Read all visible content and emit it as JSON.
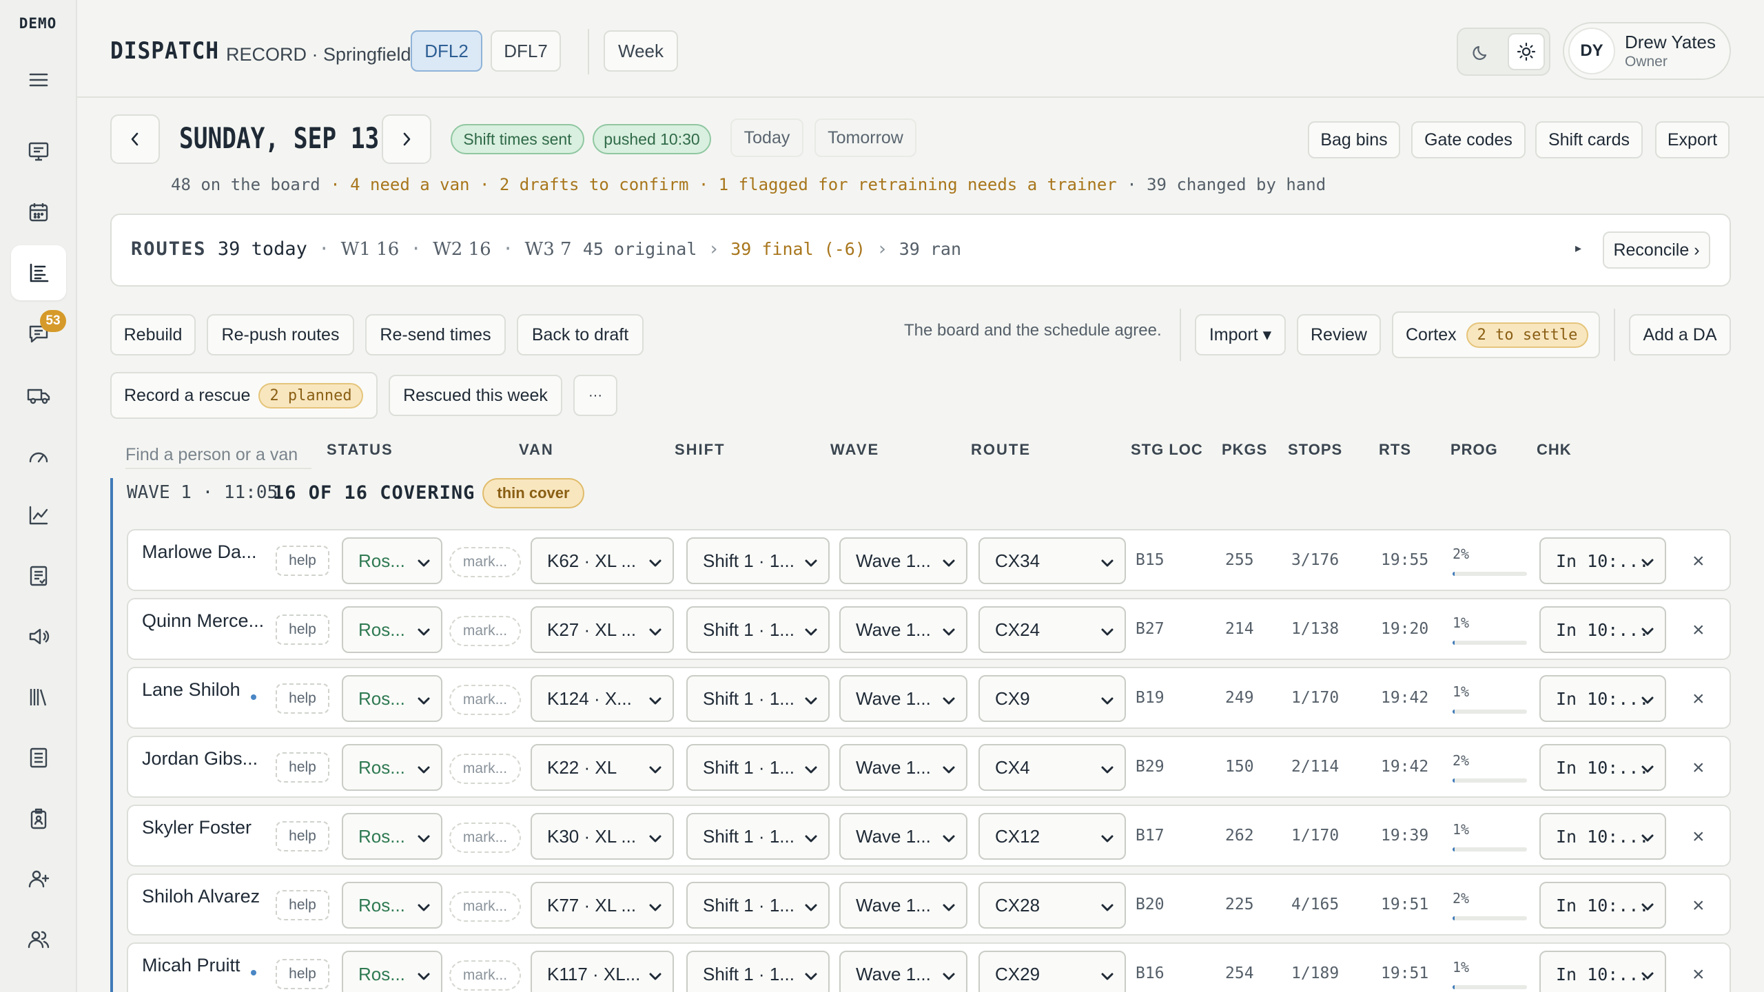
{
  "sidebar": {
    "logo": "DEMO",
    "message_count": "53",
    "icons": [
      "menu-icon",
      "monitor-icon",
      "calendar-icon",
      "dispatch-board-icon",
      "messages-icon",
      "truck-icon",
      "gauge-icon",
      "chart-icon",
      "report-icon",
      "announce-icon",
      "library-icon",
      "checklist-icon",
      "badge-icon",
      "add-user-icon",
      "people-icon"
    ]
  },
  "header": {
    "app": "DISPATCH",
    "mode": "RECORD · Springfield",
    "stations": [
      "DFL2",
      "DFL7"
    ],
    "active_station": "DFL2",
    "week": "Week",
    "user_initials": "DY",
    "user_name": "Drew Yates",
    "user_role": "Owner"
  },
  "date_bar": {
    "title": "SUNDAY, SEP 13",
    "pill_sent": "Shift times sent",
    "pill_pushed": "pushed 10:30",
    "today": "Today",
    "tomorrow": "Tomorrow",
    "actions": [
      "Bag bins",
      "Gate codes",
      "Shift cards",
      "Export"
    ]
  },
  "summary": {
    "on_board": "48 on the board",
    "sep": "·",
    "need_van": "4 need a van",
    "drafts": "2 drafts to confirm",
    "flagged": "1 flagged for retraining needs a trainer",
    "changed": "39 changed by hand"
  },
  "routes": {
    "label": "ROUTES",
    "today": "39 today",
    "w1": "W1 16",
    "w2": "W2 16",
    "w3": "W3 7",
    "original": "45 original",
    "arrow": "›",
    "final": "39 final (-6)",
    "ran": "39 ran",
    "tri": "▸",
    "reconcile": "Reconcile ›"
  },
  "toolbar": {
    "rebuild": "Rebuild",
    "repush": "Re-push routes",
    "resend": "Re-send times",
    "back": "Back to draft",
    "agree": "The board and the schedule agree.",
    "import": "Import ▾",
    "review": "Review",
    "cortex": "Cortex",
    "cortex_badge": "2 to settle",
    "add_da": "Add a DA",
    "rescue": "Record a rescue",
    "rescue_badge": "2 planned",
    "rescued_week": "Rescued this week",
    "more": "···"
  },
  "table": {
    "search_placeholder": "Find a person or a van",
    "headers": {
      "status": "STATUS",
      "van": "VAN",
      "shift": "SHIFT",
      "wave": "WAVE",
      "route": "ROUTE",
      "stg": "STG LOC",
      "pkgs": "PKGS",
      "stops": "STOPS",
      "rts": "RTS",
      "prog": "PROG",
      "chk": "CHK"
    },
    "wave_label": "WAVE 1 · 11:05",
    "wave_cover": "16 OF 16 COVERING",
    "wave_badge": "thin cover",
    "help": "help",
    "mark": "mark...",
    "close": "×",
    "rows": [
      {
        "name": "Marlowe Da...",
        "dot": false,
        "status": "Ros...",
        "van": "K62 · XL ...",
        "shift": "Shift 1 · 1...",
        "wave": "Wave 1...",
        "route": "CX34",
        "stg": "B15",
        "pkgs": "255",
        "stops": "3/176",
        "rts": "19:55",
        "prog": "2%",
        "prog_value": 2,
        "chk": "In 10:..."
      },
      {
        "name": "Quinn Merce...",
        "dot": false,
        "status": "Ros...",
        "van": "K27 · XL ...",
        "shift": "Shift 1 · 1...",
        "wave": "Wave 1...",
        "route": "CX24",
        "stg": "B27",
        "pkgs": "214",
        "stops": "1/138",
        "rts": "19:20",
        "prog": "1%",
        "prog_value": 1,
        "chk": "In 10:..."
      },
      {
        "name": "Lane Shiloh",
        "dot": true,
        "status": "Ros...",
        "van": "K124 · X...",
        "shift": "Shift 1 · 1...",
        "wave": "Wave 1...",
        "route": "CX9",
        "stg": "B19",
        "pkgs": "249",
        "stops": "1/170",
        "rts": "19:42",
        "prog": "1%",
        "prog_value": 1,
        "chk": "In 10:..."
      },
      {
        "name": "Jordan Gibs...",
        "dot": false,
        "status": "Ros...",
        "van": "K22 · XL",
        "shift": "Shift 1 · 1...",
        "wave": "Wave 1...",
        "route": "CX4",
        "stg": "B29",
        "pkgs": "150",
        "stops": "2/114",
        "rts": "19:42",
        "prog": "2%",
        "prog_value": 2,
        "chk": "In 10:..."
      },
      {
        "name": "Skyler Foster",
        "dot": false,
        "status": "Ros...",
        "van": "K30 · XL ...",
        "shift": "Shift 1 · 1...",
        "wave": "Wave 1...",
        "route": "CX12",
        "stg": "B17",
        "pkgs": "262",
        "stops": "1/170",
        "rts": "19:39",
        "prog": "1%",
        "prog_value": 1,
        "chk": "In 10:..."
      },
      {
        "name": "Shiloh Alvarez",
        "dot": false,
        "status": "Ros...",
        "van": "K77 · XL ...",
        "shift": "Shift 1 · 1...",
        "wave": "Wave 1...",
        "route": "CX28",
        "stg": "B20",
        "pkgs": "225",
        "stops": "4/165",
        "rts": "19:51",
        "prog": "2%",
        "prog_value": 2,
        "chk": "In 10:..."
      },
      {
        "name": "Micah Pruitt",
        "dot": true,
        "status": "Ros...",
        "van": "K117 · XL...",
        "shift": "Shift 1 · 1...",
        "wave": "Wave 1...",
        "route": "CX29",
        "stg": "B16",
        "pkgs": "254",
        "stops": "1/189",
        "rts": "19:51",
        "prog": "1%",
        "prog_value": 1,
        "chk": "In 10:..."
      }
    ]
  },
  "colors": {
    "accent": "#3f7ab8",
    "status_green": "#2f7a52",
    "amber": "#a8761c",
    "pill_green_bg": "#d9efdf",
    "amber_bg": "#f8e6bf"
  }
}
